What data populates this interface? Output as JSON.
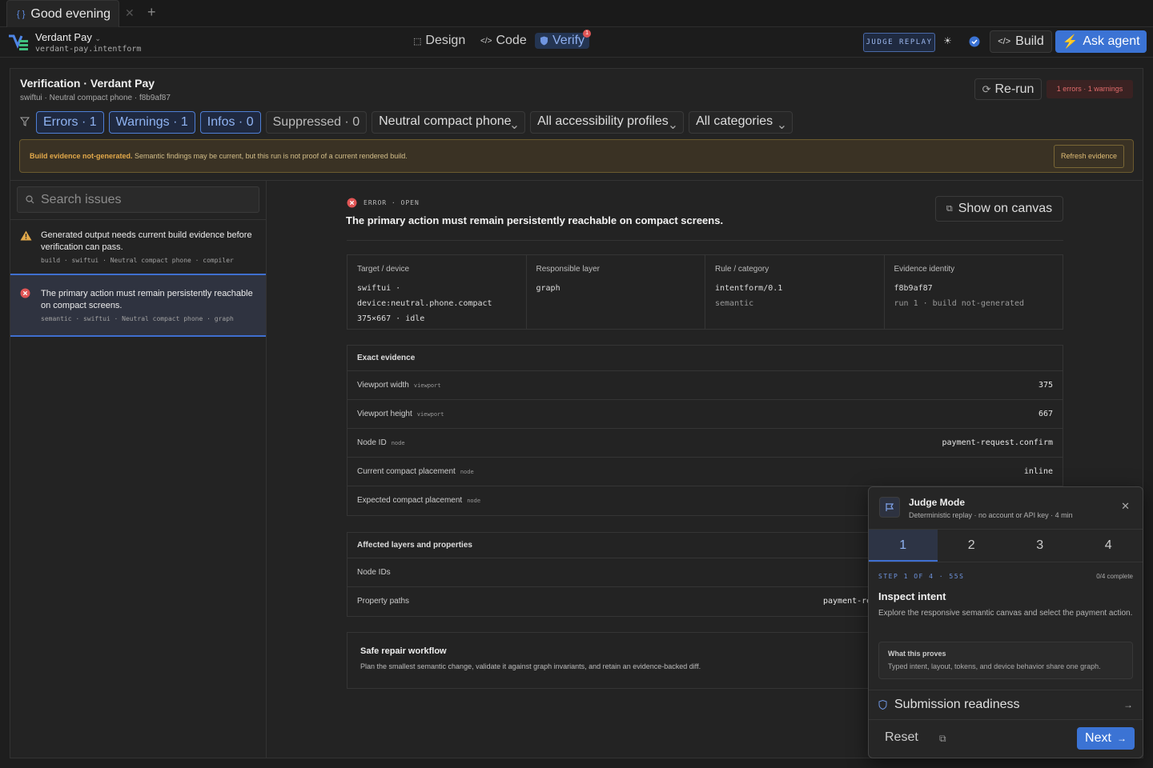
{
  "tab": {
    "icon": "code-braces-icon",
    "title": "Good evening"
  },
  "project": {
    "name": "Verdant Pay",
    "file": "verdant-pay.intentform"
  },
  "modes": [
    {
      "label": "Design",
      "icon": "frame-icon",
      "active": false
    },
    {
      "label": "Code",
      "icon": "code-icon",
      "active": false
    },
    {
      "label": "Verify",
      "icon": "shield-icon",
      "active": true,
      "badge": "1"
    }
  ],
  "header": {
    "judge_replay": "JUDGE REPLAY",
    "build": "Build",
    "ask_agent": "Ask agent"
  },
  "verification": {
    "title": "Verification · Verdant Pay",
    "subtitle": "swiftui · Neutral compact phone · f8b9af87",
    "rerun": "Re-run",
    "summary": "1 errors · 1 warnings"
  },
  "filters": {
    "chips": [
      "Errors · 1",
      "Warnings · 1",
      "Infos · 0",
      "Suppressed · 0"
    ],
    "device": "Neutral compact phone",
    "accessibility": "All accessibility profiles",
    "category": "All categories"
  },
  "banner": {
    "strong": "Build evidence not-generated.",
    "text": "Semantic findings may be current, but this run is not proof of a current rendered build.",
    "action": "Refresh evidence"
  },
  "search": {
    "placeholder": "Search issues"
  },
  "issues": [
    {
      "severity": "warning",
      "title": "Generated output needs current build evidence before verification can pass.",
      "meta": "build · swiftui · Neutral compact phone · compiler"
    },
    {
      "severity": "error",
      "title": "The primary action must remain persistently reachable on compact screens.",
      "meta": "semantic · swiftui · Neutral compact phone · graph"
    }
  ],
  "detail": {
    "status": "ERROR · OPEN",
    "title": "The primary action must remain persistently reachable on compact screens.",
    "show_on_canvas": "Show on canvas",
    "cards": [
      {
        "label": "Target / device",
        "lines": [
          "swiftui ·",
          "device:neutral.phone.compact",
          "375×667 · idle"
        ]
      },
      {
        "label": "Responsible layer",
        "lines": [
          "graph"
        ]
      },
      {
        "label": "Rule / category",
        "lines": [
          "intentform/0.1",
          "semantic"
        ]
      },
      {
        "label": "Evidence identity",
        "lines": [
          "f8b9af87",
          "run 1 · build not-generated"
        ]
      }
    ],
    "exact_evidence": {
      "title": "Exact evidence",
      "rows": [
        {
          "label": "Viewport width",
          "tag": "viewport",
          "value": "375"
        },
        {
          "label": "Viewport height",
          "tag": "viewport",
          "value": "667"
        },
        {
          "label": "Node ID",
          "tag": "node",
          "value": "payment-request.confirm"
        },
        {
          "label": "Current compact placement",
          "tag": "node",
          "value": "inline"
        },
        {
          "label": "Expected compact placement",
          "tag": "node",
          "value": ""
        }
      ]
    },
    "affected": {
      "title": "Affected layers and properties",
      "rows": [
        {
          "label": "Node IDs",
          "value": ""
        },
        {
          "label": "Property paths",
          "value": "payment-re"
        }
      ]
    },
    "repair": {
      "title": "Safe repair workflow",
      "text": "Plan the smallest semantic change, validate it against graph invariants, and retain an evidence-backed diff."
    }
  },
  "judge_mode": {
    "title": "Judge Mode",
    "subtitle": "Deterministic replay · no account or API key · 4 min",
    "steps": [
      "1",
      "2",
      "3",
      "4"
    ],
    "active_step": 1,
    "step_label": "STEP 1 OF 4 · 55S",
    "progress": "0/4 complete",
    "heading": "Inspect intent",
    "text": "Explore the responsive semantic canvas and select the payment action.",
    "proves_title": "What this proves",
    "proves_text": "Typed intent, layout, tokens, and device behavior share one graph.",
    "readiness": "Submission readiness",
    "reset": "Reset",
    "next": "Next"
  },
  "colors": {
    "accent": "#3b73d4",
    "error": "#e05555",
    "warning": "#e3a94a",
    "background": "#1e1e1e"
  }
}
